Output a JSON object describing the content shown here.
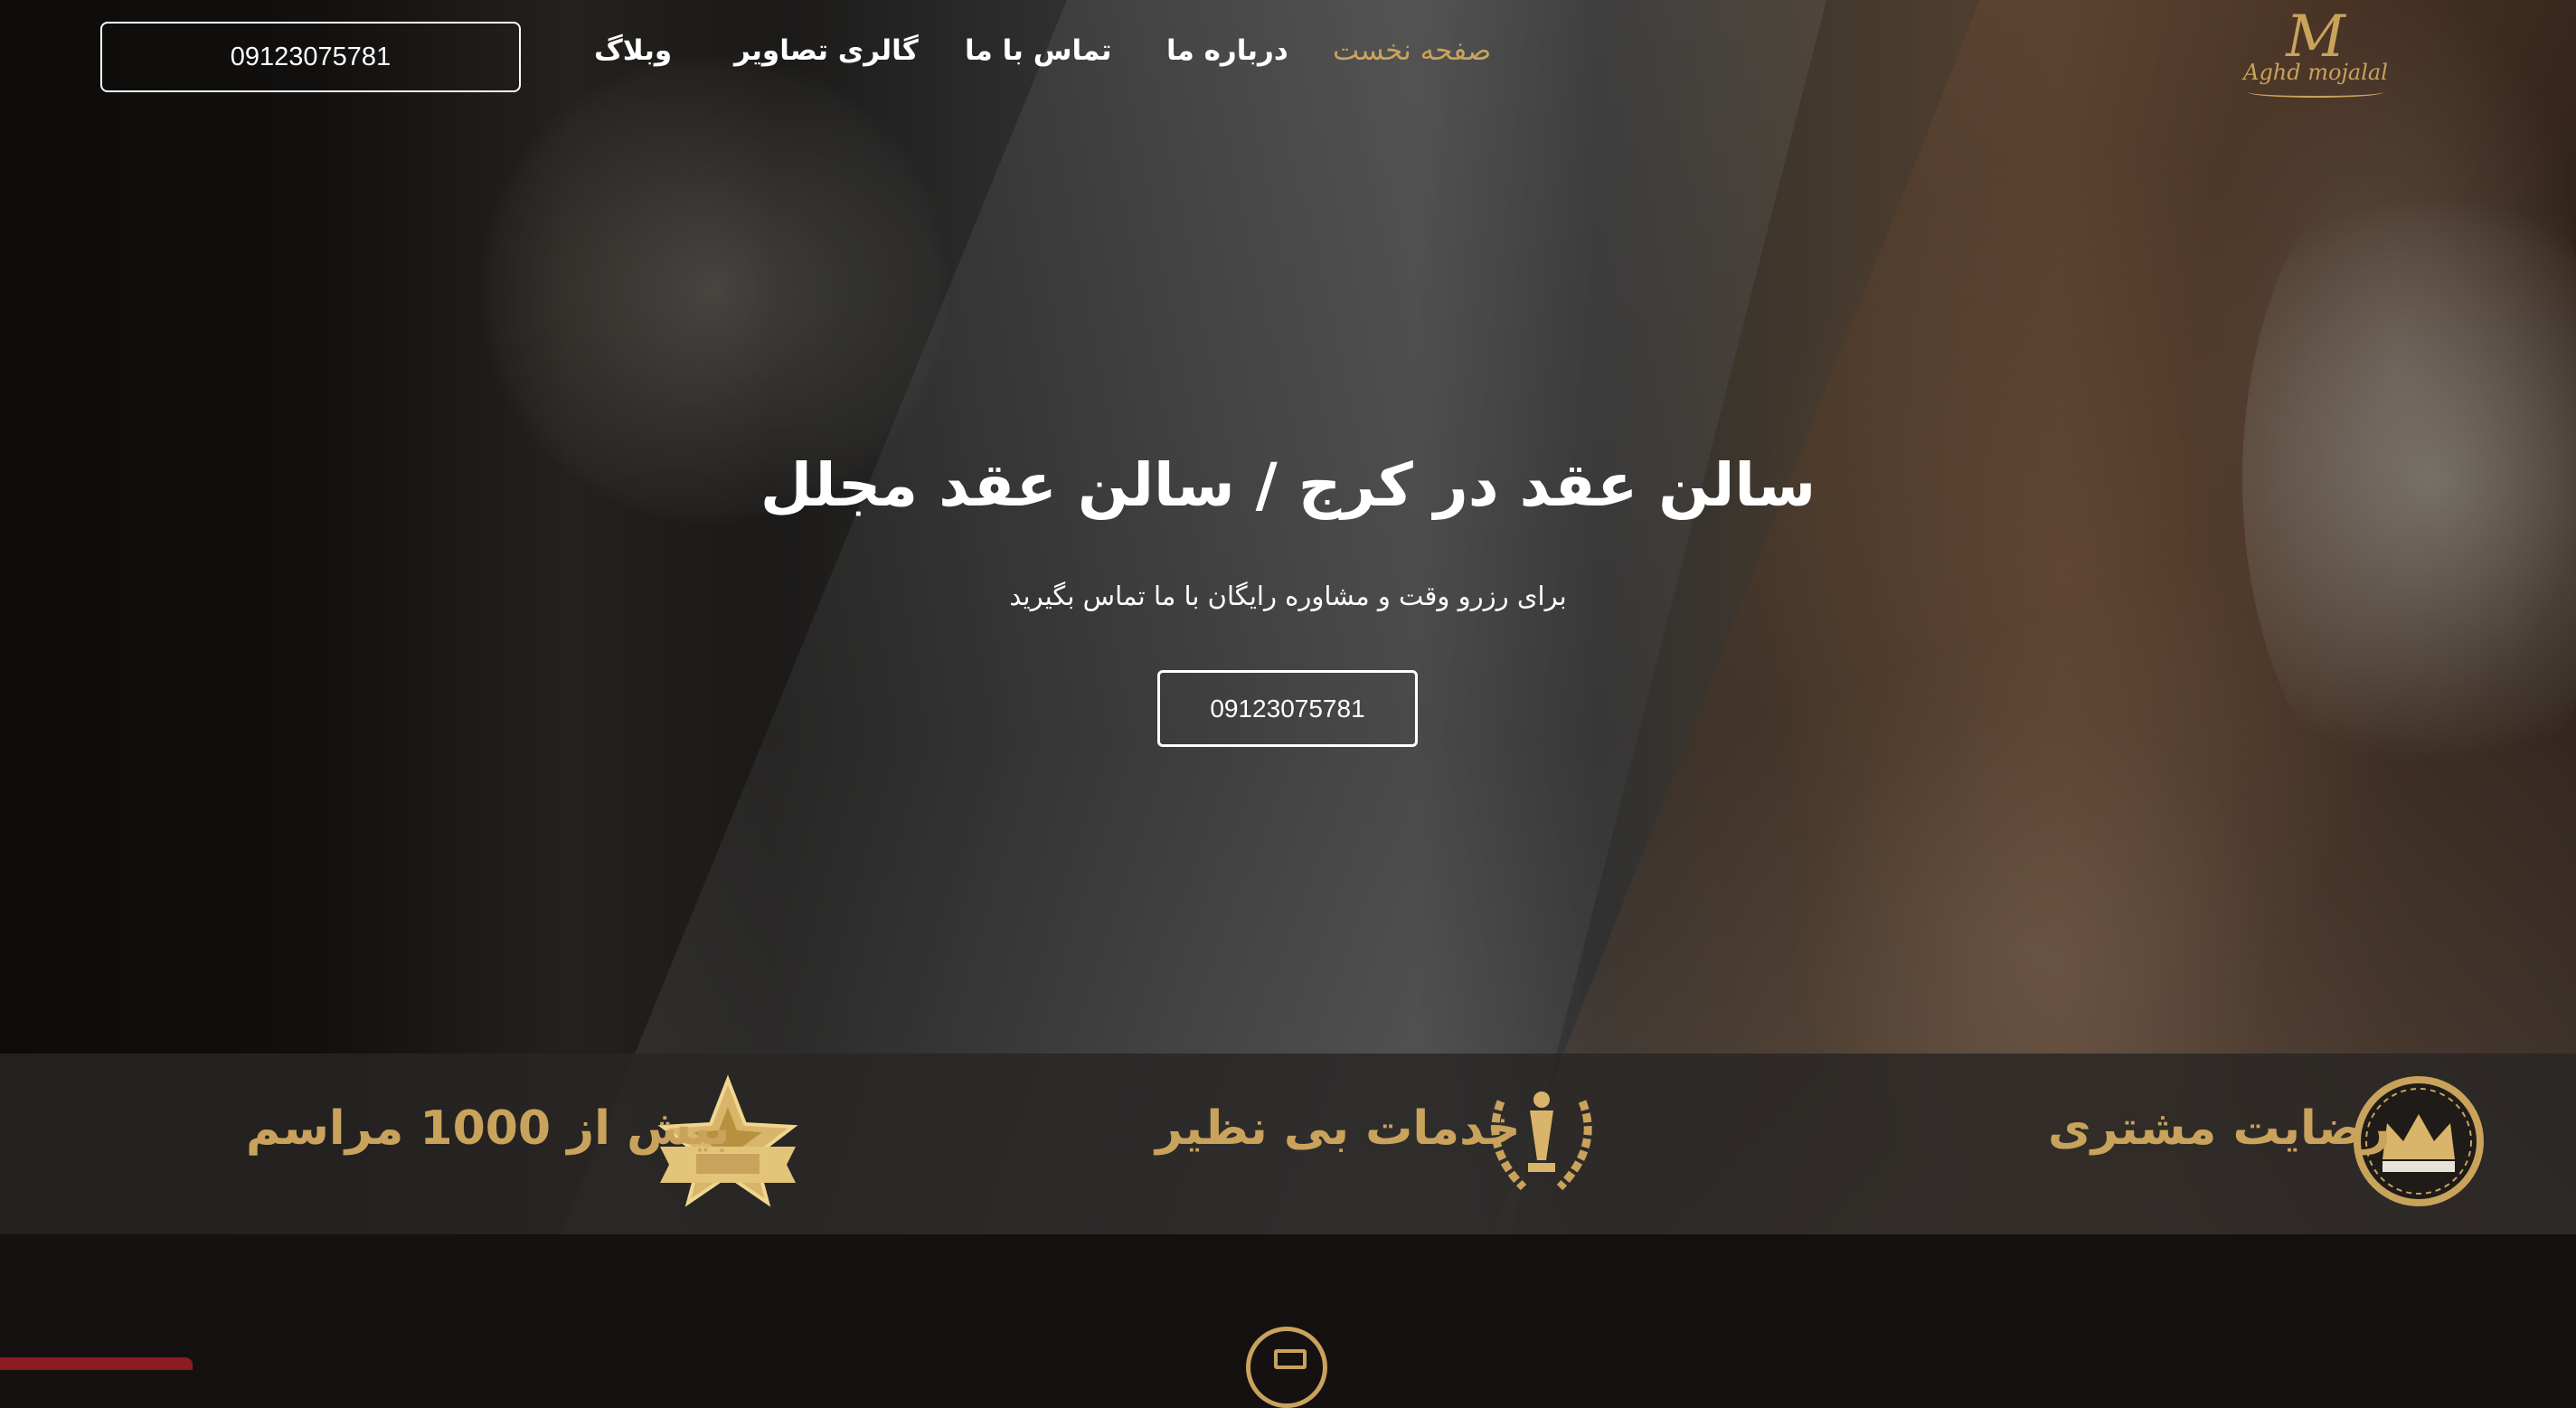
{
  "header": {
    "logo": {
      "monogram": "M",
      "text": "Aghd mojalal"
    },
    "nav": [
      {
        "label": "صفحه نخست",
        "active": true
      },
      {
        "label": "درباره ما",
        "active": false
      },
      {
        "label": "تماس با ما",
        "active": false
      },
      {
        "label": "گالری تصاویر",
        "active": false
      },
      {
        "label": "وبلاگ",
        "active": false
      }
    ],
    "phone": "09123075781"
  },
  "hero": {
    "title": "سالن عقد در کرج / سالن عقد مجلل",
    "subtitle": "برای رزرو وقت و مشاوره رایگان با ما تماس بگیرید",
    "phone_button": "09123075781"
  },
  "features": [
    {
      "label": "رضایت مشتری",
      "icon": "crown-icon"
    },
    {
      "label": "خدمات بی نظیر",
      "icon": "trophy-icon"
    },
    {
      "label": "بیش از 1000 مراسم",
      "icon": "star-badge-icon"
    }
  ],
  "colors": {
    "accent_gold": "#c9a35c",
    "bar_background": "#282624",
    "page_background": "#141110",
    "red_tab": "#8e1b22"
  }
}
